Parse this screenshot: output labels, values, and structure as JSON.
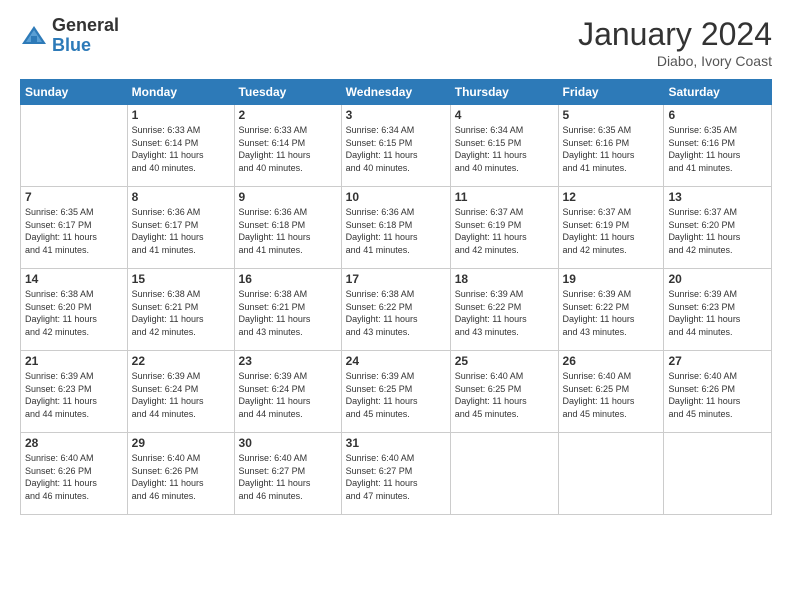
{
  "logo": {
    "general": "General",
    "blue": "Blue"
  },
  "header": {
    "title": "January 2024",
    "location": "Diabo, Ivory Coast"
  },
  "weekdays": [
    "Sunday",
    "Monday",
    "Tuesday",
    "Wednesday",
    "Thursday",
    "Friday",
    "Saturday"
  ],
  "weeks": [
    [
      {
        "day": "",
        "info": ""
      },
      {
        "day": "1",
        "info": "Sunrise: 6:33 AM\nSunset: 6:14 PM\nDaylight: 11 hours\nand 40 minutes."
      },
      {
        "day": "2",
        "info": "Sunrise: 6:33 AM\nSunset: 6:14 PM\nDaylight: 11 hours\nand 40 minutes."
      },
      {
        "day": "3",
        "info": "Sunrise: 6:34 AM\nSunset: 6:15 PM\nDaylight: 11 hours\nand 40 minutes."
      },
      {
        "day": "4",
        "info": "Sunrise: 6:34 AM\nSunset: 6:15 PM\nDaylight: 11 hours\nand 40 minutes."
      },
      {
        "day": "5",
        "info": "Sunrise: 6:35 AM\nSunset: 6:16 PM\nDaylight: 11 hours\nand 41 minutes."
      },
      {
        "day": "6",
        "info": "Sunrise: 6:35 AM\nSunset: 6:16 PM\nDaylight: 11 hours\nand 41 minutes."
      }
    ],
    [
      {
        "day": "7",
        "info": "Sunrise: 6:35 AM\nSunset: 6:17 PM\nDaylight: 11 hours\nand 41 minutes."
      },
      {
        "day": "8",
        "info": "Sunrise: 6:36 AM\nSunset: 6:17 PM\nDaylight: 11 hours\nand 41 minutes."
      },
      {
        "day": "9",
        "info": "Sunrise: 6:36 AM\nSunset: 6:18 PM\nDaylight: 11 hours\nand 41 minutes."
      },
      {
        "day": "10",
        "info": "Sunrise: 6:36 AM\nSunset: 6:18 PM\nDaylight: 11 hours\nand 41 minutes."
      },
      {
        "day": "11",
        "info": "Sunrise: 6:37 AM\nSunset: 6:19 PM\nDaylight: 11 hours\nand 42 minutes."
      },
      {
        "day": "12",
        "info": "Sunrise: 6:37 AM\nSunset: 6:19 PM\nDaylight: 11 hours\nand 42 minutes."
      },
      {
        "day": "13",
        "info": "Sunrise: 6:37 AM\nSunset: 6:20 PM\nDaylight: 11 hours\nand 42 minutes."
      }
    ],
    [
      {
        "day": "14",
        "info": "Sunrise: 6:38 AM\nSunset: 6:20 PM\nDaylight: 11 hours\nand 42 minutes."
      },
      {
        "day": "15",
        "info": "Sunrise: 6:38 AM\nSunset: 6:21 PM\nDaylight: 11 hours\nand 42 minutes."
      },
      {
        "day": "16",
        "info": "Sunrise: 6:38 AM\nSunset: 6:21 PM\nDaylight: 11 hours\nand 43 minutes."
      },
      {
        "day": "17",
        "info": "Sunrise: 6:38 AM\nSunset: 6:22 PM\nDaylight: 11 hours\nand 43 minutes."
      },
      {
        "day": "18",
        "info": "Sunrise: 6:39 AM\nSunset: 6:22 PM\nDaylight: 11 hours\nand 43 minutes."
      },
      {
        "day": "19",
        "info": "Sunrise: 6:39 AM\nSunset: 6:22 PM\nDaylight: 11 hours\nand 43 minutes."
      },
      {
        "day": "20",
        "info": "Sunrise: 6:39 AM\nSunset: 6:23 PM\nDaylight: 11 hours\nand 44 minutes."
      }
    ],
    [
      {
        "day": "21",
        "info": "Sunrise: 6:39 AM\nSunset: 6:23 PM\nDaylight: 11 hours\nand 44 minutes."
      },
      {
        "day": "22",
        "info": "Sunrise: 6:39 AM\nSunset: 6:24 PM\nDaylight: 11 hours\nand 44 minutes."
      },
      {
        "day": "23",
        "info": "Sunrise: 6:39 AM\nSunset: 6:24 PM\nDaylight: 11 hours\nand 44 minutes."
      },
      {
        "day": "24",
        "info": "Sunrise: 6:39 AM\nSunset: 6:25 PM\nDaylight: 11 hours\nand 45 minutes."
      },
      {
        "day": "25",
        "info": "Sunrise: 6:40 AM\nSunset: 6:25 PM\nDaylight: 11 hours\nand 45 minutes."
      },
      {
        "day": "26",
        "info": "Sunrise: 6:40 AM\nSunset: 6:25 PM\nDaylight: 11 hours\nand 45 minutes."
      },
      {
        "day": "27",
        "info": "Sunrise: 6:40 AM\nSunset: 6:26 PM\nDaylight: 11 hours\nand 45 minutes."
      }
    ],
    [
      {
        "day": "28",
        "info": "Sunrise: 6:40 AM\nSunset: 6:26 PM\nDaylight: 11 hours\nand 46 minutes."
      },
      {
        "day": "29",
        "info": "Sunrise: 6:40 AM\nSunset: 6:26 PM\nDaylight: 11 hours\nand 46 minutes."
      },
      {
        "day": "30",
        "info": "Sunrise: 6:40 AM\nSunset: 6:27 PM\nDaylight: 11 hours\nand 46 minutes."
      },
      {
        "day": "31",
        "info": "Sunrise: 6:40 AM\nSunset: 6:27 PM\nDaylight: 11 hours\nand 47 minutes."
      },
      {
        "day": "",
        "info": ""
      },
      {
        "day": "",
        "info": ""
      },
      {
        "day": "",
        "info": ""
      }
    ]
  ]
}
